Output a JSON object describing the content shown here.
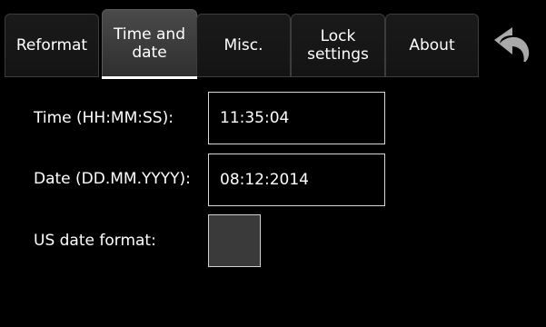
{
  "tabs": [
    {
      "label": "Reformat"
    },
    {
      "label": "Time and\ndate"
    },
    {
      "label": "Misc."
    },
    {
      "label": "Lock\nsettings"
    },
    {
      "label": "About"
    }
  ],
  "active_tab": 1,
  "back_icon": "undo-arrow-icon",
  "form": {
    "time_label": "Time (HH:MM:SS):",
    "time_value": "11:35:04",
    "date_label": "Date (DD.MM.YYYY):",
    "date_value": "08:12:2014",
    "us_date_label": "US date format:",
    "us_date_checked": false
  }
}
